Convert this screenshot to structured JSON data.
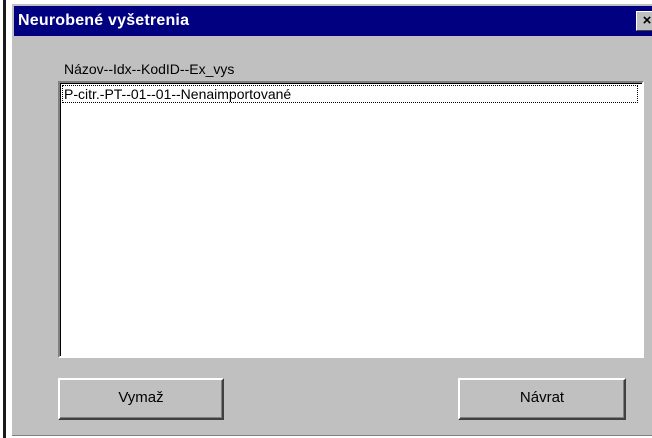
{
  "window": {
    "title": "Neurobené vyšetrenia",
    "close_glyph": "×"
  },
  "list": {
    "header": "Názov--Idx--KodID--Ex_vys",
    "items": [
      {
        "label": "P-citr.-PT--01--01--Nenaimportované"
      }
    ]
  },
  "buttons": {
    "delete_label": "Vymaž",
    "return_label": "Návrat"
  },
  "colors": {
    "titlebar": "#000080",
    "face": "#c0c0c0",
    "list_bg": "#ffffff"
  }
}
